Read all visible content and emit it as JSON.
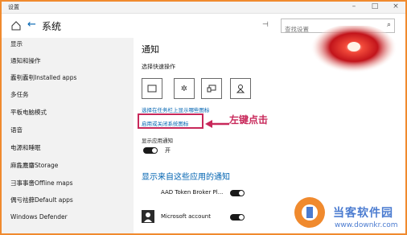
{
  "window": {
    "title": "设置"
  },
  "header": {
    "title": "系统",
    "search_placeholder": "查找设置"
  },
  "sidebar": {
    "items": [
      {
        "label": "显示"
      },
      {
        "label": "通知和操作"
      },
      {
        "label": "蠹刳蠹刳Installed apps"
      },
      {
        "label": "多任务"
      },
      {
        "label": "平板电脑模式"
      },
      {
        "label": "语音"
      },
      {
        "label": "电源和睡眠"
      },
      {
        "label": "麻麁麎麏Storage"
      },
      {
        "label": "彐事事嗇Offline maps"
      },
      {
        "label": "偶亏祛藓Default apps"
      },
      {
        "label": "Windows Defender"
      }
    ]
  },
  "main": {
    "title": "通知",
    "quick_actions_label": "选择快速操作",
    "link_taskbar_icons": "选择在任务栏上显示哪些图标",
    "link_system_icons": "启用或关闭系统图标",
    "app_notifications_label": "显示应用通知",
    "toggle_state_text": "开",
    "section_heading": "显示来自这些应用的通知",
    "apps": [
      {
        "name": "AAD Token Broker Pl..."
      },
      {
        "name": "Microsoft account"
      }
    ]
  },
  "annotation": {
    "text": "左键点击"
  },
  "watermark": {
    "brand": "当客软件园",
    "url": "www.downkr.com"
  },
  "icons": {
    "quick_actions": [
      "tablet-mode-icon",
      "settings-icon",
      "connect-icon",
      "location-icon"
    ]
  },
  "colors": {
    "accent": "#0063b1",
    "annotation": "#c8285a",
    "frame": "#f08a2e"
  }
}
